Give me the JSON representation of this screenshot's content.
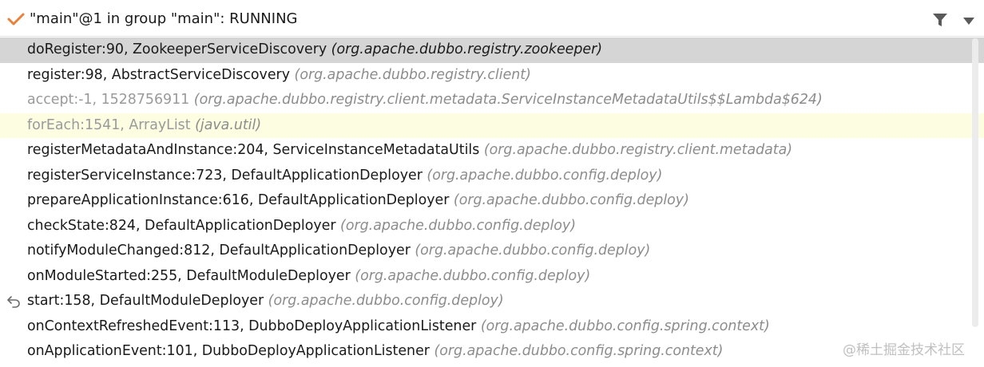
{
  "header": {
    "thread_title": "\"main\"@1 in group \"main\": RUNNING",
    "status_icon": "checkmark-icon",
    "filter_icon": "filter-icon",
    "dropdown_icon": "chevron-down-icon"
  },
  "frames": [
    {
      "method": "doRegister:90, ZookeeperServiceDiscovery",
      "package": "(org.apache.dubbo.registry.zookeeper)"
    },
    {
      "method": "register:98, AbstractServiceDiscovery",
      "package": "(org.apache.dubbo.registry.client)"
    },
    {
      "method": "accept:-1, 1528756911",
      "package": "(org.apache.dubbo.registry.client.metadata.ServiceInstanceMetadataUtils$$Lambda$624)"
    },
    {
      "method": "forEach:1541, ArrayList",
      "package": "(java.util)"
    },
    {
      "method": "registerMetadataAndInstance:204, ServiceInstanceMetadataUtils",
      "package": "(org.apache.dubbo.registry.client.metadata)"
    },
    {
      "method": "registerServiceInstance:723, DefaultApplicationDeployer",
      "package": "(org.apache.dubbo.config.deploy)"
    },
    {
      "method": "prepareApplicationInstance:616, DefaultApplicationDeployer",
      "package": "(org.apache.dubbo.config.deploy)"
    },
    {
      "method": "checkState:824, DefaultApplicationDeployer",
      "package": "(org.apache.dubbo.config.deploy)"
    },
    {
      "method": "notifyModuleChanged:812, DefaultApplicationDeployer",
      "package": "(org.apache.dubbo.config.deploy)"
    },
    {
      "method": "onModuleStarted:255, DefaultModuleDeployer",
      "package": "(org.apache.dubbo.config.deploy)"
    },
    {
      "method": "start:158, DefaultModuleDeployer",
      "package": "(org.apache.dubbo.config.deploy)",
      "icon": "drop-frame-icon"
    },
    {
      "method": "onContextRefreshedEvent:113, DubboDeployApplicationListener",
      "package": "(org.apache.dubbo.config.spring.context)"
    },
    {
      "method": "onApplicationEvent:101, DubboDeployApplicationListener",
      "package": "(org.apache.dubbo.config.spring.context)"
    }
  ],
  "watermark": "@稀土掘金技术社区",
  "colors": {
    "selected_row": "#d5d5d5",
    "current_row": "#fdfde2",
    "check_orange": "#e8823a"
  }
}
